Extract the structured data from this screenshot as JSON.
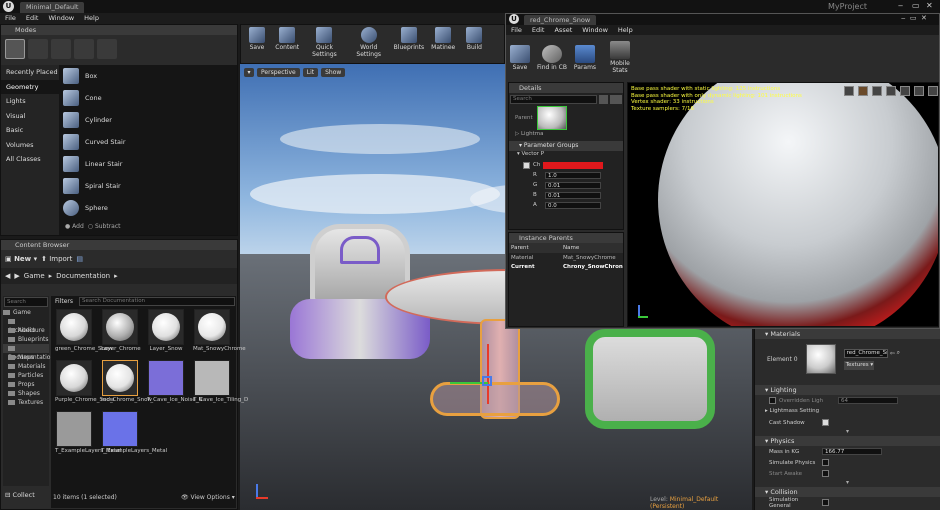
{
  "main_window": {
    "tab_title": "Minimal_Default",
    "project_name": "MyProject",
    "menu": [
      "File",
      "Edit",
      "Window",
      "Help"
    ]
  },
  "modes": {
    "tab": "Modes",
    "categories": [
      "Recently Placed",
      "Geometry",
      "Lights",
      "Visual",
      "Basic",
      "Volumes",
      "All Classes"
    ],
    "selected_category": "Geometry",
    "items": [
      "Box",
      "Cone",
      "Cylinder",
      "Curved Stair",
      "Linear Stair",
      "Spiral Stair",
      "Sphere"
    ],
    "add_label": "Add",
    "subtract_label": "Subtract"
  },
  "toolbar": {
    "buttons": [
      "Save",
      "Content",
      "Quick Settings",
      "World Settings",
      "Blueprints",
      "Matinee",
      "Build"
    ]
  },
  "viewport": {
    "perspective": "Perspective",
    "lit": "Lit",
    "show": "Show",
    "level_label": "Level:",
    "level_name": "Minimal_Default (Persistent)"
  },
  "content_browser": {
    "tab": "Content Browser",
    "new_label": "New",
    "import_label": "Import",
    "path": [
      "Game",
      "Documentation"
    ],
    "filters_label": "Filters",
    "search_placeholder": "Search Documentation",
    "folder_search_placeholder": "Search",
    "tree_root": "Game",
    "tree_items": [
      "Architecture",
      "Audio",
      "Blueprints",
      "Documentation",
      "Maps",
      "Materials",
      "Particles",
      "Props",
      "Shapes",
      "Textures"
    ],
    "assets": [
      {
        "name": "green_Chrome_Snow",
        "kind": "sphere",
        "color": "#d8d8d8"
      },
      {
        "name": "Layer_Chrome",
        "kind": "sphere",
        "color": "#b0b0b0"
      },
      {
        "name": "Layer_Snow",
        "kind": "sphere",
        "color": "#e0e0e0"
      },
      {
        "name": "Mat_SnowyChrome",
        "kind": "sphere",
        "color": "#e8e8e8"
      },
      {
        "name": "Purple_Chrome_Snow",
        "kind": "sphere",
        "color": "#d8d8d8"
      },
      {
        "name": "red_Chrome_Snow",
        "kind": "sphere",
        "color": "#e4e4e4"
      },
      {
        "name": "T_Cave_Ice_Noise_N",
        "kind": "tex",
        "color": "#7b6ed8"
      },
      {
        "name": "T_Cave_Ice_Tiling_D",
        "kind": "tex",
        "color": "#b8b8b8"
      },
      {
        "name": "T_ExampleLayers_Metal",
        "kind": "tex",
        "color": "#9a9a9a"
      },
      {
        "name": "T_ExampleLayers_Metal",
        "kind": "tex",
        "color": "#6a72e8"
      }
    ],
    "status": "10 items (1 selected)",
    "view_options": "View Options",
    "collections_label": "Collect"
  },
  "material_window": {
    "tab_title": "red_Chrome_Snow",
    "menu": [
      "File",
      "Edit",
      "Asset",
      "Window",
      "Help"
    ],
    "toolbar": [
      "Save",
      "Find in CB",
      "Params",
      "Mobile Stats"
    ],
    "details_tab": "Details",
    "search_placeholder": "Search",
    "parent_label": "Parent",
    "lightmass_label": "Lightma",
    "parameter_groups": "Parameter Groups",
    "vector_label": "Vector P",
    "param_short": "Ch",
    "channels": [
      {
        "label": "R",
        "value": "1.0"
      },
      {
        "label": "G",
        "value": "0.01"
      },
      {
        "label": "B",
        "value": "0.01"
      },
      {
        "label": "A",
        "value": "0.0"
      }
    ],
    "instance_parents_tab": "Instance Parents",
    "parents_header": [
      "Parent",
      "Name"
    ],
    "parents_rows": [
      [
        "Material",
        "Mat_SnowyChrome"
      ],
      [
        "Current",
        "Chrony_SnowChron"
      ]
    ],
    "stats": [
      "Base pass shader with static lighting: 125 instructions",
      "Base pass shader with only dynamic lighting: 101 instructions",
      "Vertex shader: 33 instructions",
      "Texture samplers: 7/16"
    ]
  },
  "details": {
    "materials_header": "Materials",
    "element_label": "Element 0",
    "material_value": "red_Chrome_Sn",
    "textures_label": "Textures",
    "lighting_header": "Lighting",
    "override_label": "Overridden Ligh",
    "override_value": "64",
    "lightmass_settings": "Lightmass Setting",
    "cast_shadow": "Cast Shadow",
    "physics_header": "Physics",
    "mass_label": "Mass in KG",
    "mass_value": "166.77",
    "simulate_physics": "Simulate Physics",
    "start_awake": "Start Awake",
    "collision_header": "Collision",
    "simulation_general": "Simulation General"
  }
}
